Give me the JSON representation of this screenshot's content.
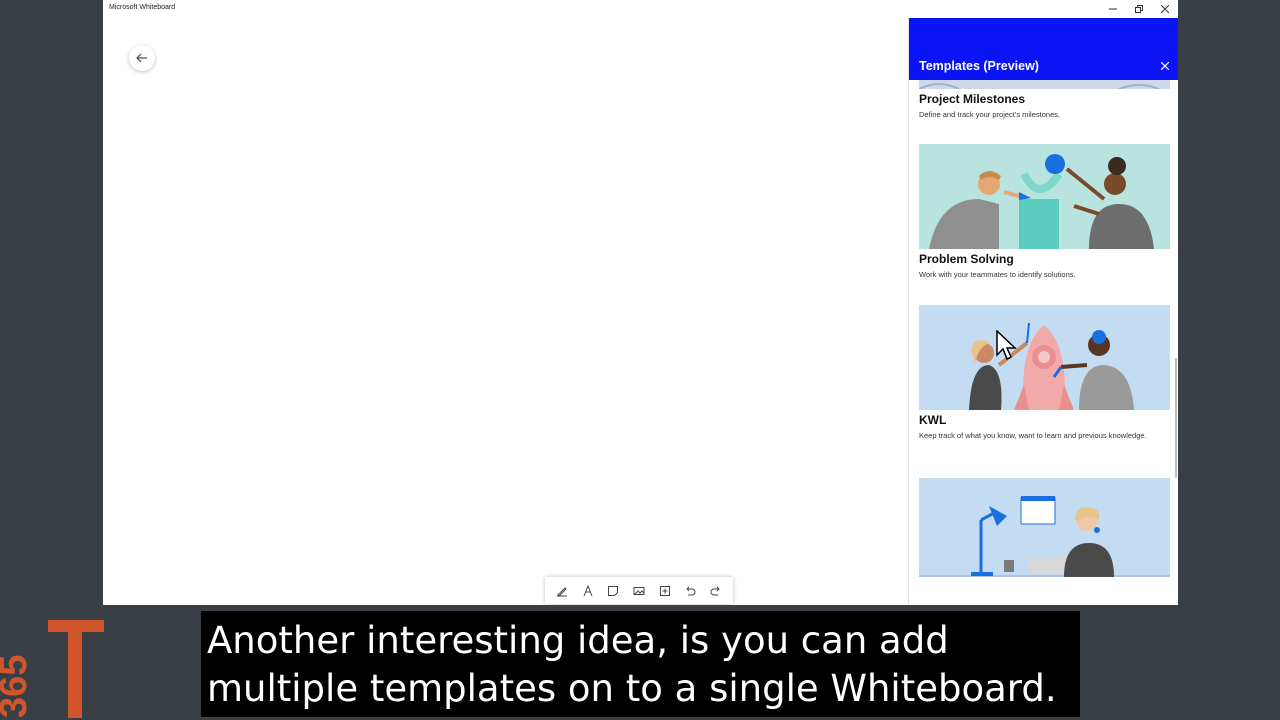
{
  "window": {
    "title": "Microsoft Whiteboard"
  },
  "panel": {
    "title": "Templates (Preview)",
    "templates": [
      {
        "name": "Project Milestones",
        "description": "Define and track your project's milestones."
      },
      {
        "name": "Problem Solving",
        "description": "Work with your teammates to identify solutions."
      },
      {
        "name": "KWL",
        "description": "Keep track of what you know, want to learn and previous knowledge."
      }
    ]
  },
  "subtitles": [
    "Another interesting idea, is you can add",
    "multiple templates on to a single Whiteboard."
  ],
  "logo": {
    "text": "365"
  },
  "colors": {
    "panel_header": "#0a14f5",
    "logo": "#d0552a",
    "background": "#3a3f45"
  },
  "icons": {
    "back": "arrow-left-icon",
    "toolbar": [
      "pen-icon",
      "text-icon",
      "sticky-note-icon",
      "image-icon",
      "insert-icon",
      "undo-icon",
      "redo-icon"
    ]
  }
}
